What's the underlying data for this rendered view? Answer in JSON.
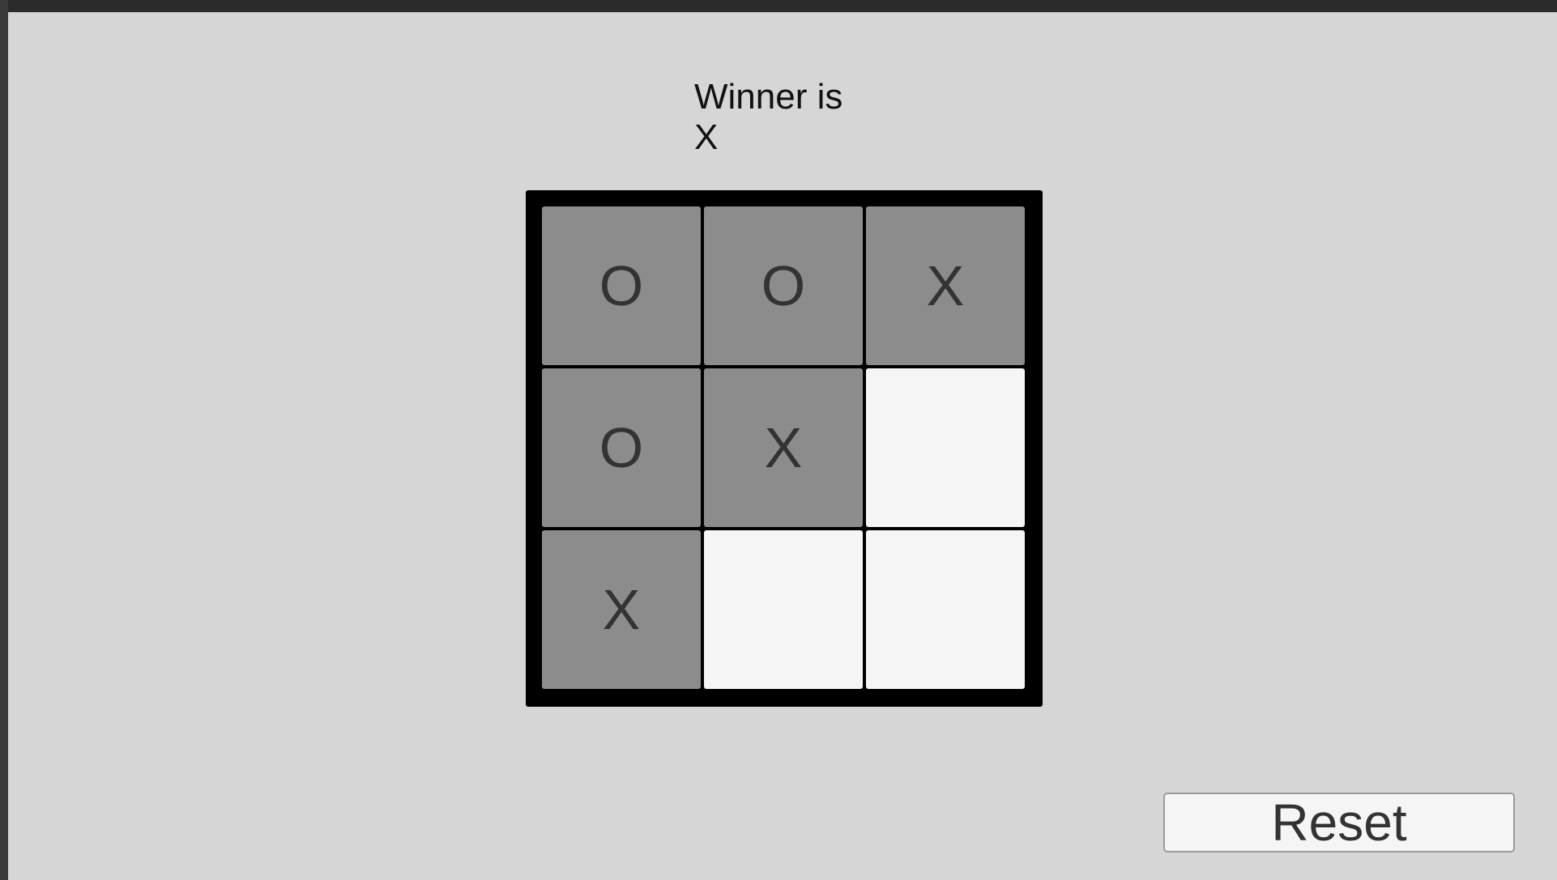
{
  "status": {
    "winner_text": "Winner is\nX"
  },
  "board": {
    "cells": [
      [
        "O",
        "O",
        "X"
      ],
      [
        "O",
        "X",
        ""
      ],
      [
        "X",
        "",
        ""
      ]
    ]
  },
  "controls": {
    "reset_label": "Reset"
  },
  "colors": {
    "filled_cell": "#8c8c8c",
    "empty_cell": "#f5f5f5",
    "board_frame": "#000000",
    "background": "#d6d6d6"
  }
}
